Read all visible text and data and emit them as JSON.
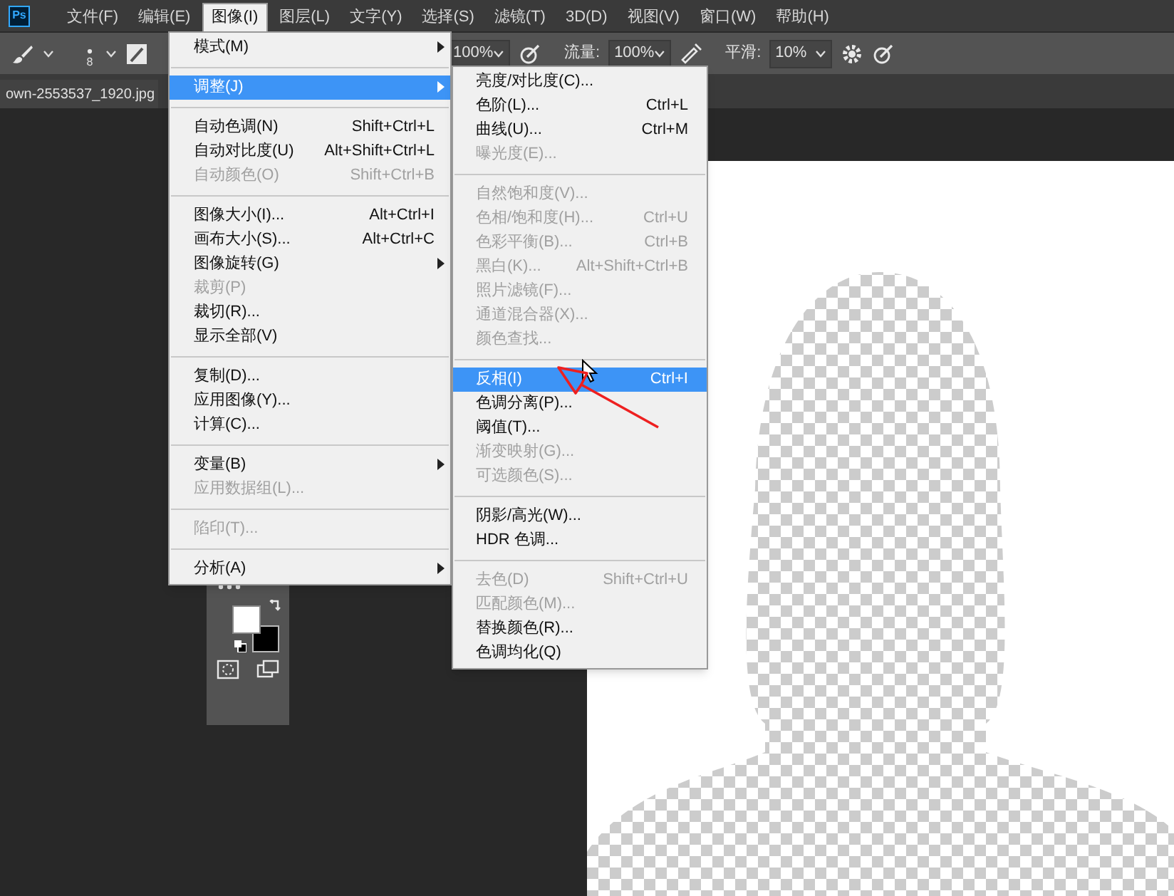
{
  "menubar": {
    "logo": "Ps",
    "items": [
      {
        "label": "文件(F)",
        "selected": false
      },
      {
        "label": "编辑(E)",
        "selected": false
      },
      {
        "label": "图像(I)",
        "selected": true
      },
      {
        "label": "图层(L)",
        "selected": false
      },
      {
        "label": "文字(Y)",
        "selected": false
      },
      {
        "label": "选择(S)",
        "selected": false
      },
      {
        "label": "滤镜(T)",
        "selected": false
      },
      {
        "label": "3D(D)",
        "selected": false
      },
      {
        "label": "视图(V)",
        "selected": false
      },
      {
        "label": "窗口(W)",
        "selected": false
      },
      {
        "label": "帮助(H)",
        "selected": false
      }
    ]
  },
  "options_bar": {
    "brush_size": "8",
    "opacity": "100%",
    "flow_label": "流量:",
    "flow": "100%",
    "smoothing_label": "平滑:",
    "smoothing": "10%"
  },
  "document_tab": {
    "title": "own-2553537_1920.jpg"
  },
  "image_menu": {
    "items": [
      {
        "kind": "item",
        "label": "模式(M)",
        "disabled": false,
        "submenu": true,
        "selected": false
      },
      {
        "kind": "separator"
      },
      {
        "kind": "item",
        "label": "调整(J)",
        "disabled": false,
        "submenu": true,
        "selected": true
      },
      {
        "kind": "separator"
      },
      {
        "kind": "item",
        "label": "自动色调(N)",
        "shortcut": "Shift+Ctrl+L",
        "disabled": false,
        "submenu": false,
        "selected": false
      },
      {
        "kind": "item",
        "label": "自动对比度(U)",
        "shortcut": "Alt+Shift+Ctrl+L",
        "disabled": false,
        "submenu": false,
        "selected": false
      },
      {
        "kind": "item",
        "label": "自动颜色(O)",
        "shortcut": "Shift+Ctrl+B",
        "disabled": true,
        "submenu": false,
        "selected": false
      },
      {
        "kind": "separator"
      },
      {
        "kind": "item",
        "label": "图像大小(I)...",
        "shortcut": "Alt+Ctrl+I",
        "disabled": false,
        "submenu": false,
        "selected": false
      },
      {
        "kind": "item",
        "label": "画布大小(S)...",
        "shortcut": "Alt+Ctrl+C",
        "disabled": false,
        "submenu": false,
        "selected": false
      },
      {
        "kind": "item",
        "label": "图像旋转(G)",
        "disabled": false,
        "submenu": true,
        "selected": false
      },
      {
        "kind": "item",
        "label": "裁剪(P)",
        "disabled": true,
        "submenu": false,
        "selected": false
      },
      {
        "kind": "item",
        "label": "裁切(R)...",
        "disabled": false,
        "submenu": false,
        "selected": false
      },
      {
        "kind": "item",
        "label": "显示全部(V)",
        "disabled": false,
        "submenu": false,
        "selected": false
      },
      {
        "kind": "separator"
      },
      {
        "kind": "item",
        "label": "复制(D)...",
        "disabled": false,
        "submenu": false,
        "selected": false
      },
      {
        "kind": "item",
        "label": "应用图像(Y)...",
        "disabled": false,
        "submenu": false,
        "selected": false
      },
      {
        "kind": "item",
        "label": "计算(C)...",
        "disabled": false,
        "submenu": false,
        "selected": false
      },
      {
        "kind": "separator"
      },
      {
        "kind": "item",
        "label": "变量(B)",
        "disabled": false,
        "submenu": true,
        "selected": false
      },
      {
        "kind": "item",
        "label": "应用数据组(L)...",
        "disabled": true,
        "submenu": false,
        "selected": false
      },
      {
        "kind": "separator"
      },
      {
        "kind": "item",
        "label": "陷印(T)...",
        "disabled": true,
        "submenu": false,
        "selected": false
      },
      {
        "kind": "separator"
      },
      {
        "kind": "item",
        "label": "分析(A)",
        "disabled": false,
        "submenu": true,
        "selected": false
      }
    ]
  },
  "adjustments_submenu": {
    "items": [
      {
        "kind": "item",
        "label": "亮度/对比度(C)...",
        "disabled": false,
        "selected": false
      },
      {
        "kind": "item",
        "label": "色阶(L)...",
        "shortcut": "Ctrl+L",
        "disabled": false,
        "selected": false
      },
      {
        "kind": "item",
        "label": "曲线(U)...",
        "shortcut": "Ctrl+M",
        "disabled": false,
        "selected": false
      },
      {
        "kind": "item",
        "label": "曝光度(E)...",
        "disabled": true,
        "selected": false
      },
      {
        "kind": "separator"
      },
      {
        "kind": "item",
        "label": "自然饱和度(V)...",
        "disabled": true,
        "selected": false
      },
      {
        "kind": "item",
        "label": "色相/饱和度(H)...",
        "shortcut": "Ctrl+U",
        "disabled": true,
        "selected": false
      },
      {
        "kind": "item",
        "label": "色彩平衡(B)...",
        "shortcut": "Ctrl+B",
        "disabled": true,
        "selected": false
      },
      {
        "kind": "item",
        "label": "黑白(K)...",
        "shortcut": "Alt+Shift+Ctrl+B",
        "disabled": true,
        "selected": false
      },
      {
        "kind": "item",
        "label": "照片滤镜(F)...",
        "disabled": true,
        "selected": false
      },
      {
        "kind": "item",
        "label": "通道混合器(X)...",
        "disabled": true,
        "selected": false
      },
      {
        "kind": "item",
        "label": "颜色查找...",
        "disabled": true,
        "selected": false
      },
      {
        "kind": "separator"
      },
      {
        "kind": "item",
        "label": "反相(I)",
        "shortcut": "Ctrl+I",
        "disabled": false,
        "selected": true
      },
      {
        "kind": "item",
        "label": "色调分离(P)...",
        "disabled": false,
        "selected": false
      },
      {
        "kind": "item",
        "label": "阈值(T)...",
        "disabled": false,
        "selected": false
      },
      {
        "kind": "item",
        "label": "渐变映射(G)...",
        "disabled": true,
        "selected": false
      },
      {
        "kind": "item",
        "label": "可选颜色(S)...",
        "disabled": true,
        "selected": false
      },
      {
        "kind": "separator"
      },
      {
        "kind": "item",
        "label": "阴影/高光(W)...",
        "disabled": false,
        "selected": false
      },
      {
        "kind": "item",
        "label": "HDR 色调...",
        "disabled": false,
        "selected": false
      },
      {
        "kind": "separator"
      },
      {
        "kind": "item",
        "label": "去色(D)",
        "shortcut": "Shift+Ctrl+U",
        "disabled": true,
        "selected": false
      },
      {
        "kind": "item",
        "label": "匹配颜色(M)...",
        "disabled": true,
        "selected": false
      },
      {
        "kind": "item",
        "label": "替换颜色(R)...",
        "disabled": false,
        "selected": false
      },
      {
        "kind": "item",
        "label": "色调均化(Q)",
        "disabled": false,
        "selected": false
      }
    ]
  }
}
